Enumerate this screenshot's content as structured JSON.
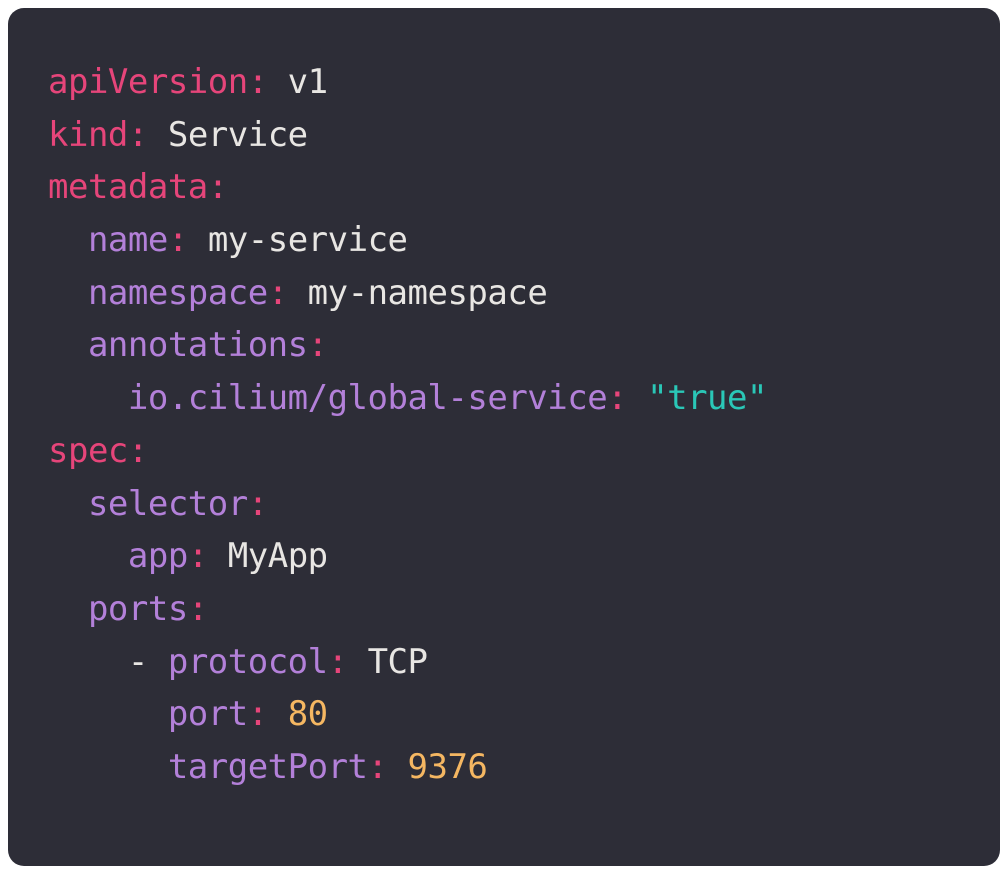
{
  "yaml": {
    "apiVersion": {
      "key": "apiVersion",
      "value": "v1"
    },
    "kind": {
      "key": "kind",
      "value": "Service"
    },
    "metadata": {
      "key": "metadata",
      "name": {
        "key": "name",
        "value": "my-service"
      },
      "namespace": {
        "key": "namespace",
        "value": "my-namespace"
      },
      "annotations": {
        "key": "annotations",
        "globalService": {
          "key": "io.cilium/global-service",
          "value": "\"true\""
        }
      }
    },
    "spec": {
      "key": "spec",
      "selector": {
        "key": "selector",
        "app": {
          "key": "app",
          "value": "MyApp"
        }
      },
      "ports": {
        "key": "ports",
        "dash": "-",
        "protocol": {
          "key": "protocol",
          "value": "TCP"
        },
        "port": {
          "key": "port",
          "value": "80"
        },
        "targetPort": {
          "key": "targetPort",
          "value": "9376"
        }
      }
    }
  }
}
